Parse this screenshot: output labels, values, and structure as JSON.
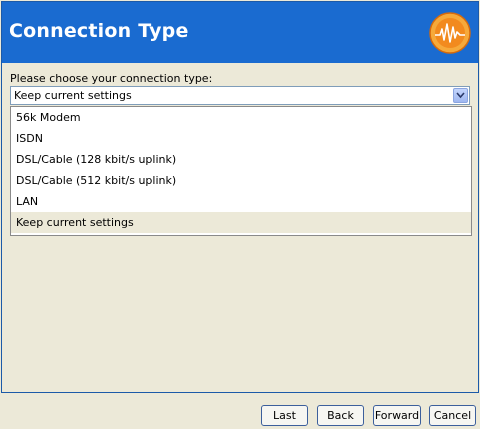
{
  "header": {
    "title": "Connection Type",
    "logo": "waveform-logo-icon",
    "colors": {
      "header_bg": "#1a6bd0",
      "logo_orange": "#f28a1e"
    }
  },
  "form": {
    "prompt": "Please choose your connection type:",
    "selected_value": "Keep current settings",
    "dropdown_icon": "chevron-down-icon",
    "options": [
      "56k Modem",
      "ISDN",
      "DSL/Cable (128 kbit/s uplink)",
      "DSL/Cable (512 kbit/s uplink)",
      "LAN",
      "Keep current settings"
    ]
  },
  "footer": {
    "last": "Last",
    "back": "Back",
    "forward": "Forward",
    "cancel": "Cancel"
  }
}
